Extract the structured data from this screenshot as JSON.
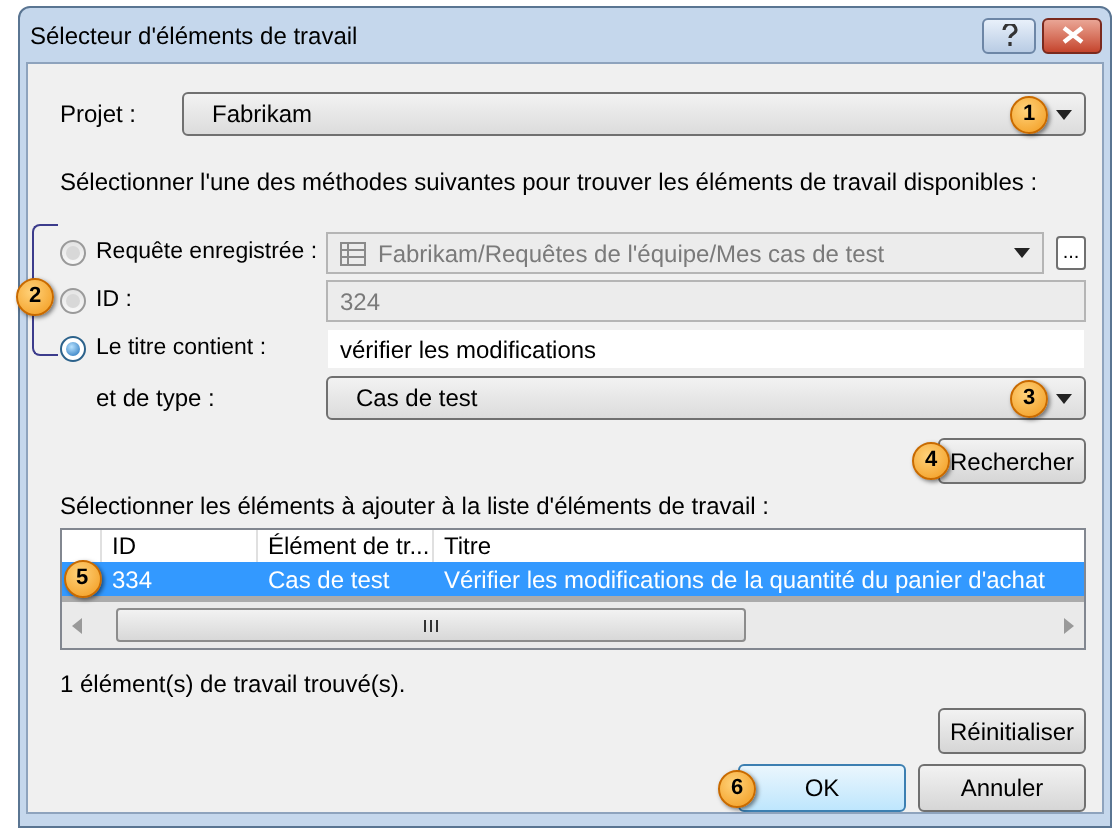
{
  "window": {
    "title": "Sélecteur d'éléments de travail"
  },
  "project": {
    "label": "Projet :",
    "value": "Fabrikam",
    "callout": "1"
  },
  "instruction": "Sélectionner l'une des méthodes suivantes pour trouver les éléments de travail disponibles :",
  "methods_callout": "2",
  "methods": [
    {
      "kind": "query",
      "label": "Requête enregistrée :",
      "value": "Fabrikam/Requêtes de l'équipe/Mes cas de test",
      "browse": "...",
      "selected": false,
      "disabled": true
    },
    {
      "kind": "text",
      "label": "ID :",
      "value": "324",
      "selected": false,
      "disabled": true
    },
    {
      "kind": "text",
      "label": "Le titre contient :",
      "value": "vérifier les modifications",
      "selected": true,
      "disabled": false
    }
  ],
  "type": {
    "label": "et de type :",
    "value": "Cas de test",
    "callout": "3"
  },
  "search_button": {
    "label": "Rechercher",
    "callout": "4"
  },
  "results": {
    "label": "Sélectionner les éléments à ajouter à la liste d'éléments de travail :",
    "columns": [
      "ID",
      "Élément de tr...",
      "Titre"
    ],
    "rows": [
      {
        "cells": [
          "334",
          "Cas de test",
          "Vérifier les modifications de la quantité du panier d'achat"
        ],
        "selected": true,
        "callout": "5"
      }
    ]
  },
  "status": "1 élément(s) de travail trouvé(s).",
  "reset_button": "Réinitialiser",
  "ok_button": {
    "label": "OK",
    "callout": "6"
  },
  "cancel_button": "Annuler"
}
